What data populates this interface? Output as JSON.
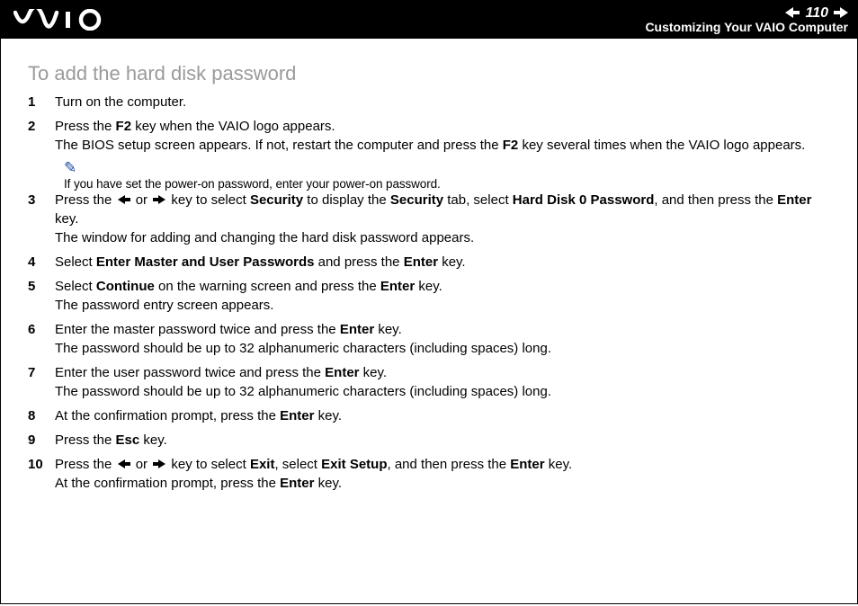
{
  "header": {
    "page_number": "110",
    "section": "Customizing Your VAIO Computer"
  },
  "title": "To add the hard disk password",
  "note": "If you have set the power-on password, enter your power-on password.",
  "steps": [
    {
      "n": "1",
      "html": "Turn on the computer."
    },
    {
      "n": "2",
      "html": "Press the <b>F2</b> key when the VAIO logo appears.<br>The BIOS setup screen appears. If not, restart the computer and press the <b>F2</b> key several times when the VAIO logo appears.",
      "note_after": true
    },
    {
      "n": "3",
      "html": "Press the <svg class='inline-arrow' width='18' height='12' viewBox='0 0 18 12'><path d='M10 1 L2 6 L10 11 L10 8 L16 8 L16 4 L10 4 Z' fill='#000'/></svg> or <svg class='inline-arrow' width='18' height='12' viewBox='0 0 18 12'><path d='M8 1 L16 6 L8 11 L8 8 L2 8 L2 4 L8 4 Z' fill='#000'/></svg> key to select <b>Security</b> to display the <b>Security</b> tab, select <b>Hard Disk 0 Password</b>, and then press the <b>Enter</b> key.<br>The window for adding and changing the hard disk password appears."
    },
    {
      "n": "4",
      "html": "Select <b>Enter Master and User Passwords</b> and press the <b>Enter</b> key."
    },
    {
      "n": "5",
      "html": "Select <b>Continue</b> on the warning screen and press the <b>Enter</b> key.<br>The password entry screen appears."
    },
    {
      "n": "6",
      "html": "Enter the master password twice and press the <b>Enter</b> key.<br>The password should be up to 32 alphanumeric characters (including spaces) long."
    },
    {
      "n": "7",
      "html": "Enter the user password twice and press the <b>Enter</b> key.<br>The password should be up to 32 alphanumeric characters (including spaces) long."
    },
    {
      "n": "8",
      "html": "At the confirmation prompt, press the <b>Enter</b> key."
    },
    {
      "n": "9",
      "html": "Press the <b>Esc</b> key."
    },
    {
      "n": "10",
      "html": "Press the <svg class='inline-arrow' width='18' height='12' viewBox='0 0 18 12'><path d='M10 1 L2 6 L10 11 L10 8 L16 8 L16 4 L10 4 Z' fill='#000'/></svg> or <svg class='inline-arrow' width='18' height='12' viewBox='0 0 18 12'><path d='M8 1 L16 6 L8 11 L8 8 L2 8 L2 4 L8 4 Z' fill='#000'/></svg> key to select <b>Exit</b>, select <b>Exit Setup</b>, and then press the <b>Enter</b> key.<br>At the confirmation prompt, press the <b>Enter</b> key."
    }
  ]
}
